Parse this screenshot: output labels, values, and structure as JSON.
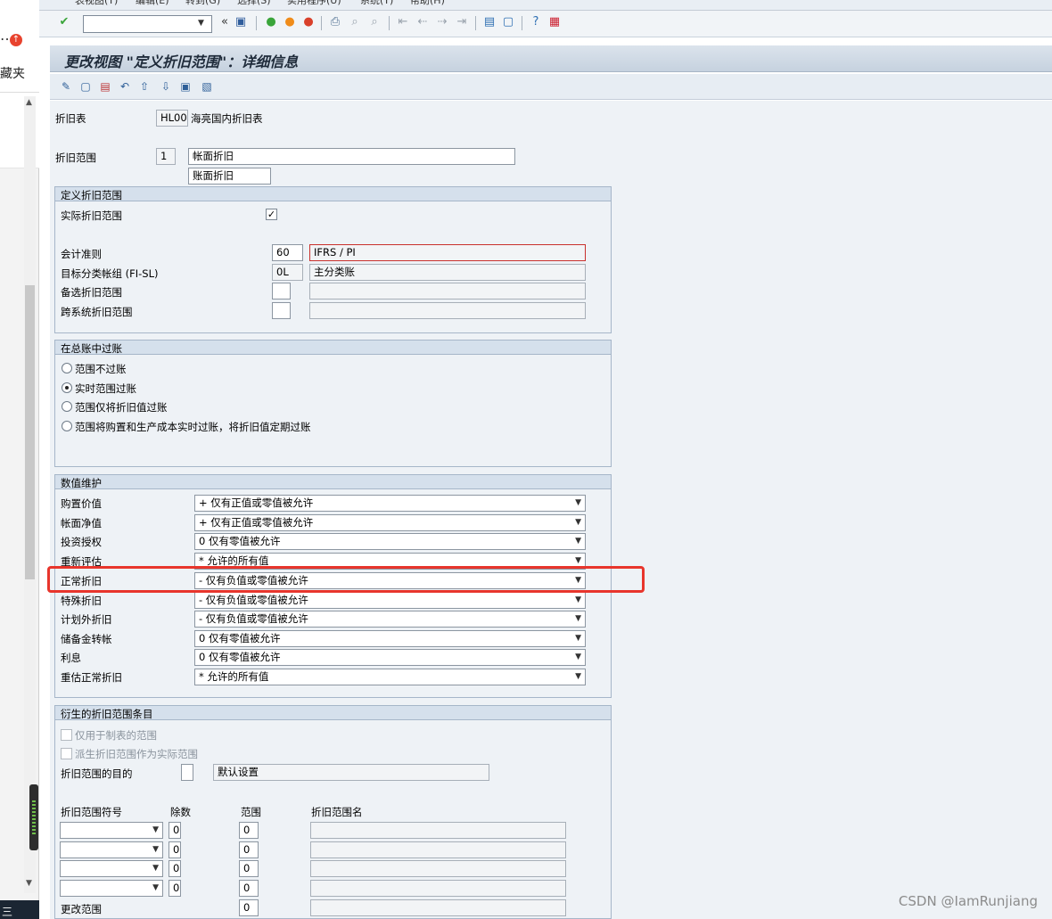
{
  "left_panel": {
    "ellipsis": "…",
    "badge_icon": "notification-arrow-icon",
    "favorites_fragment": "藏夹",
    "taskbar_fragment": "三"
  },
  "menu": {
    "items": [
      "表视图(T)",
      "编辑(E)",
      "转到(G)",
      "选择(S)",
      "实用程序(U)",
      "系统(Y)",
      "帮助(H)"
    ]
  },
  "toolbar": {
    "command_value": ""
  },
  "title": "更改视图 \"定义折旧范围\"：详细信息",
  "header": {
    "chart_label": "折旧表",
    "chart_code": "HL00",
    "chart_name": "海亮国内折旧表",
    "area_label": "折旧范围",
    "area_code": "1",
    "area_desc_long": "帐面折旧",
    "area_desc_short": "账面折旧"
  },
  "define_group": {
    "title": "定义折旧范围",
    "real_area_label": "实际折旧范围",
    "real_area_checked": "✓",
    "acct_principle_label": "会计准则",
    "acct_principle_value": "60",
    "acct_principle_desc": "IFRS / PI",
    "target_ledger_label": "目标分类帐组 (FI-SL)",
    "target_ledger_value": "0L",
    "target_ledger_desc": "主分类账",
    "alt_area_label": "备选折旧范围",
    "cross_system_label": "跨系统折旧范围"
  },
  "posting_group": {
    "title": "在总账中过账",
    "options": [
      "范围不过账",
      "实时范围过账",
      "范围仅将折旧值过账",
      "范围将购置和生产成本实时过账，将折旧值定期过账"
    ],
    "selected_index": 1
  },
  "value_group": {
    "title": "数值维护",
    "rows": [
      {
        "label": "购置价值",
        "value": "+ 仅有正值或零值被允许"
      },
      {
        "label": "帐面净值",
        "value": "+ 仅有正值或零值被允许"
      },
      {
        "label": "投资授权",
        "value": "0 仅有零值被允许"
      },
      {
        "label": "重新评估",
        "value": "* 允许的所有值"
      },
      {
        "label": "正常折旧",
        "value": "- 仅有负值或零值被允许"
      },
      {
        "label": "特殊折旧",
        "value": "- 仅有负值或零值被允许"
      },
      {
        "label": "计划外折旧",
        "value": "- 仅有负值或零值被允许"
      },
      {
        "label": "储备金转帐",
        "value": "0 仅有零值被允许"
      },
      {
        "label": "利息",
        "value": "0 仅有零值被允许"
      },
      {
        "label": "重估正常折旧",
        "value": "* 允许的所有值"
      }
    ],
    "highlighted_row": "正常折旧"
  },
  "derived_group": {
    "title": "衍生的折旧范围条目",
    "only_reporting_label": "仅用于制表的范围",
    "derived_as_real_label": "派生折旧范围作为实际范围",
    "purpose_label": "折旧范围的目的",
    "purpose_desc": "默认设置",
    "col_headers": [
      "折旧范围符号",
      "除数",
      "范围",
      "折旧范围名"
    ],
    "rows": [
      {
        "sign": "",
        "divisor": "0",
        "area": "0",
        "name": ""
      },
      {
        "sign": "",
        "divisor": "0",
        "area": "0",
        "name": ""
      },
      {
        "sign": "",
        "divisor": "0",
        "area": "0",
        "name": ""
      },
      {
        "sign": "",
        "divisor": "0",
        "area": "0",
        "name": ""
      }
    ],
    "change_area_label": "更改范围",
    "change_area_value": "0"
  },
  "watermark": "CSDN @IamRunjiang"
}
